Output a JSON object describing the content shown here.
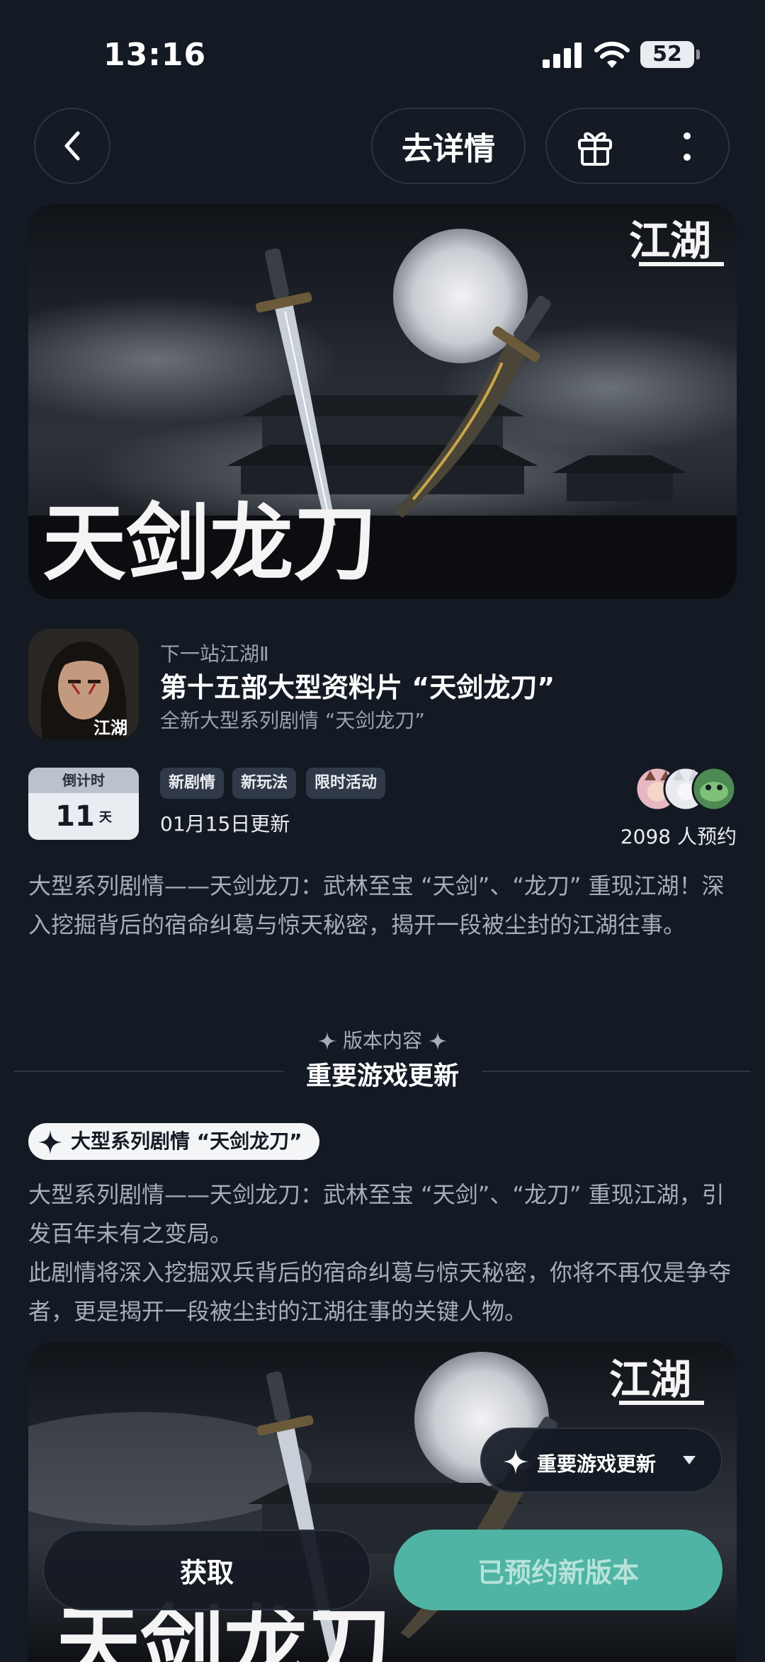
{
  "status_bar": {
    "time": "13:16",
    "battery": "52"
  },
  "nav": {
    "detail_label": "去详情"
  },
  "banner": {
    "calligraphy_title": "天剑龙刀",
    "logo_text": "江湖"
  },
  "app": {
    "subtitle": "下一站江湖Ⅱ",
    "title": "第十五部大型资料片 “天剑龙刀”",
    "description": "全新大型系列剧情 “天剑龙刀”",
    "icon_caption": "江湖"
  },
  "countdown": {
    "label": "倒计时",
    "days": "11",
    "unit": "天"
  },
  "tags": [
    "新剧情",
    "新玩法",
    "限时活动"
  ],
  "update_date": "01月15日更新",
  "reserve_count": "2098 人预约",
  "intro": "大型系列剧情——天剑龙刀：武林至宝 “天剑”、“龙刀” 重现江湖！深入挖掘背后的宿命纠葛与惊天秘密，揭开一段被尘封的江湖往事。",
  "version": {
    "label": "版本内容",
    "title": "重要游戏更新",
    "feature_tag": "大型系列剧情 “天剑龙刀”",
    "body_line1": "大型系列剧情——天剑龙刀：武林至宝 “天剑”、“龙刀” 重现江湖，引发百年未有之变局。",
    "body_line2": "此剧情将深入挖掘双兵背后的宿命纠葛与惊天秘密，你将不再仅是争夺者，更是揭开一段被尘封的江湖往事的关键人物。"
  },
  "floating_dropdown": {
    "label": "重要游戏更新"
  },
  "buttons": {
    "get": "获取",
    "reserved": "已预约新版本"
  },
  "colors": {
    "background": "#141a24",
    "accent_teal": "#4fb4a3"
  }
}
